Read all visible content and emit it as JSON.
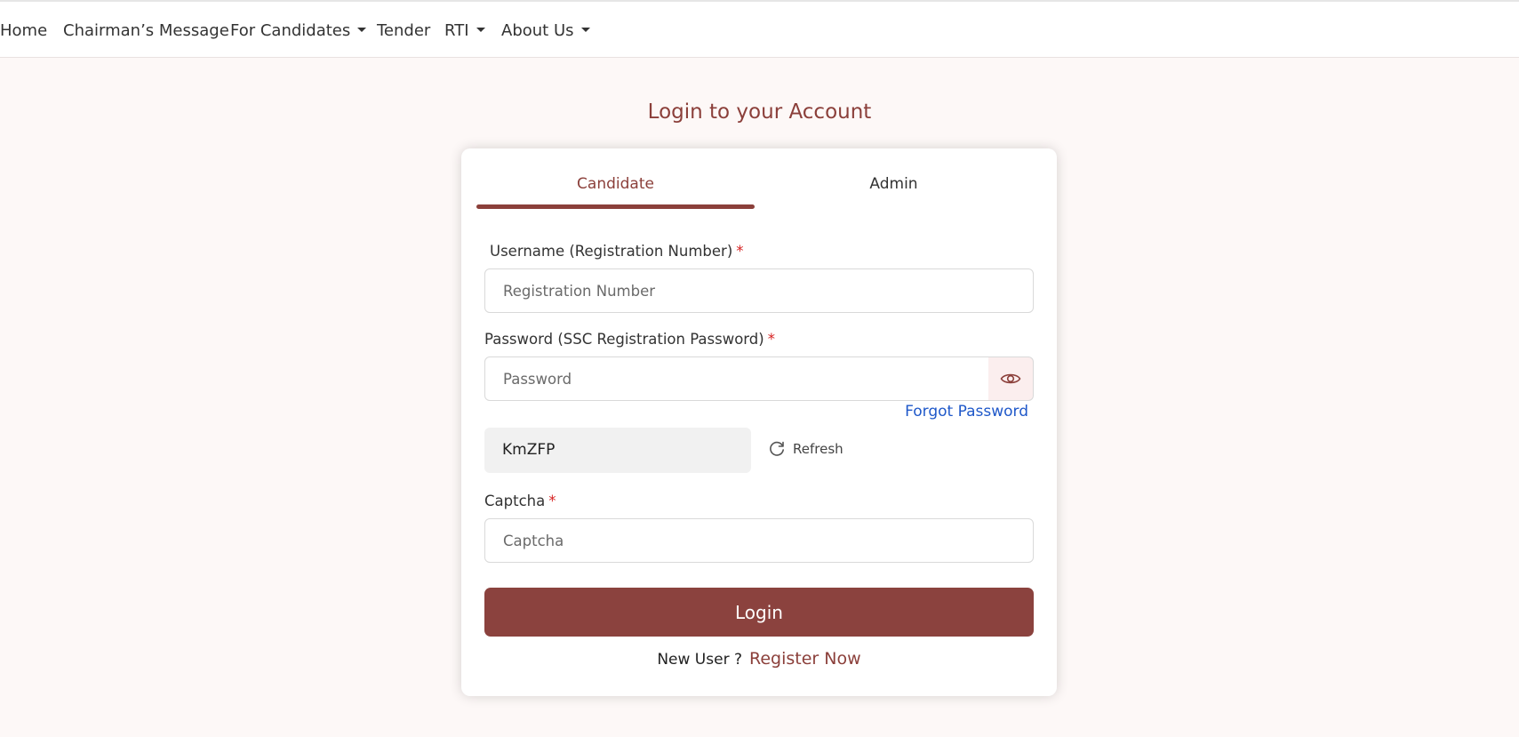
{
  "nav": {
    "items": [
      {
        "label": "Home"
      },
      {
        "label": "Chairman’s Message"
      },
      {
        "label": "For Candidates"
      },
      {
        "label": "Tender"
      },
      {
        "label": "RTI"
      },
      {
        "label": "About Us"
      }
    ]
  },
  "page": {
    "title": "Login to your Account"
  },
  "tabs": {
    "candidate": "Candidate",
    "admin": "Admin",
    "active": "Candidate"
  },
  "form": {
    "username": {
      "label": "Username (Registration Number)",
      "required": "*",
      "placeholder": "Registration Number",
      "value": ""
    },
    "password": {
      "label": "Password (SSC Registration Password)",
      "required": "*",
      "placeholder": "Password",
      "value": "",
      "toggle_icon": "eye-icon"
    },
    "forgot_password": "Forgot Password",
    "captcha_code": "KmZFP",
    "refresh_label": "Refresh",
    "captcha": {
      "label": "Captcha",
      "required": "*",
      "placeholder": "Captcha",
      "value": ""
    },
    "login_label": "Login",
    "new_user": "New User ?",
    "register": "Register Now"
  },
  "colors": {
    "accent": "#8b3f3a",
    "link": "#1f58c9",
    "required": "#d62222",
    "background": "#fdf8f7"
  }
}
